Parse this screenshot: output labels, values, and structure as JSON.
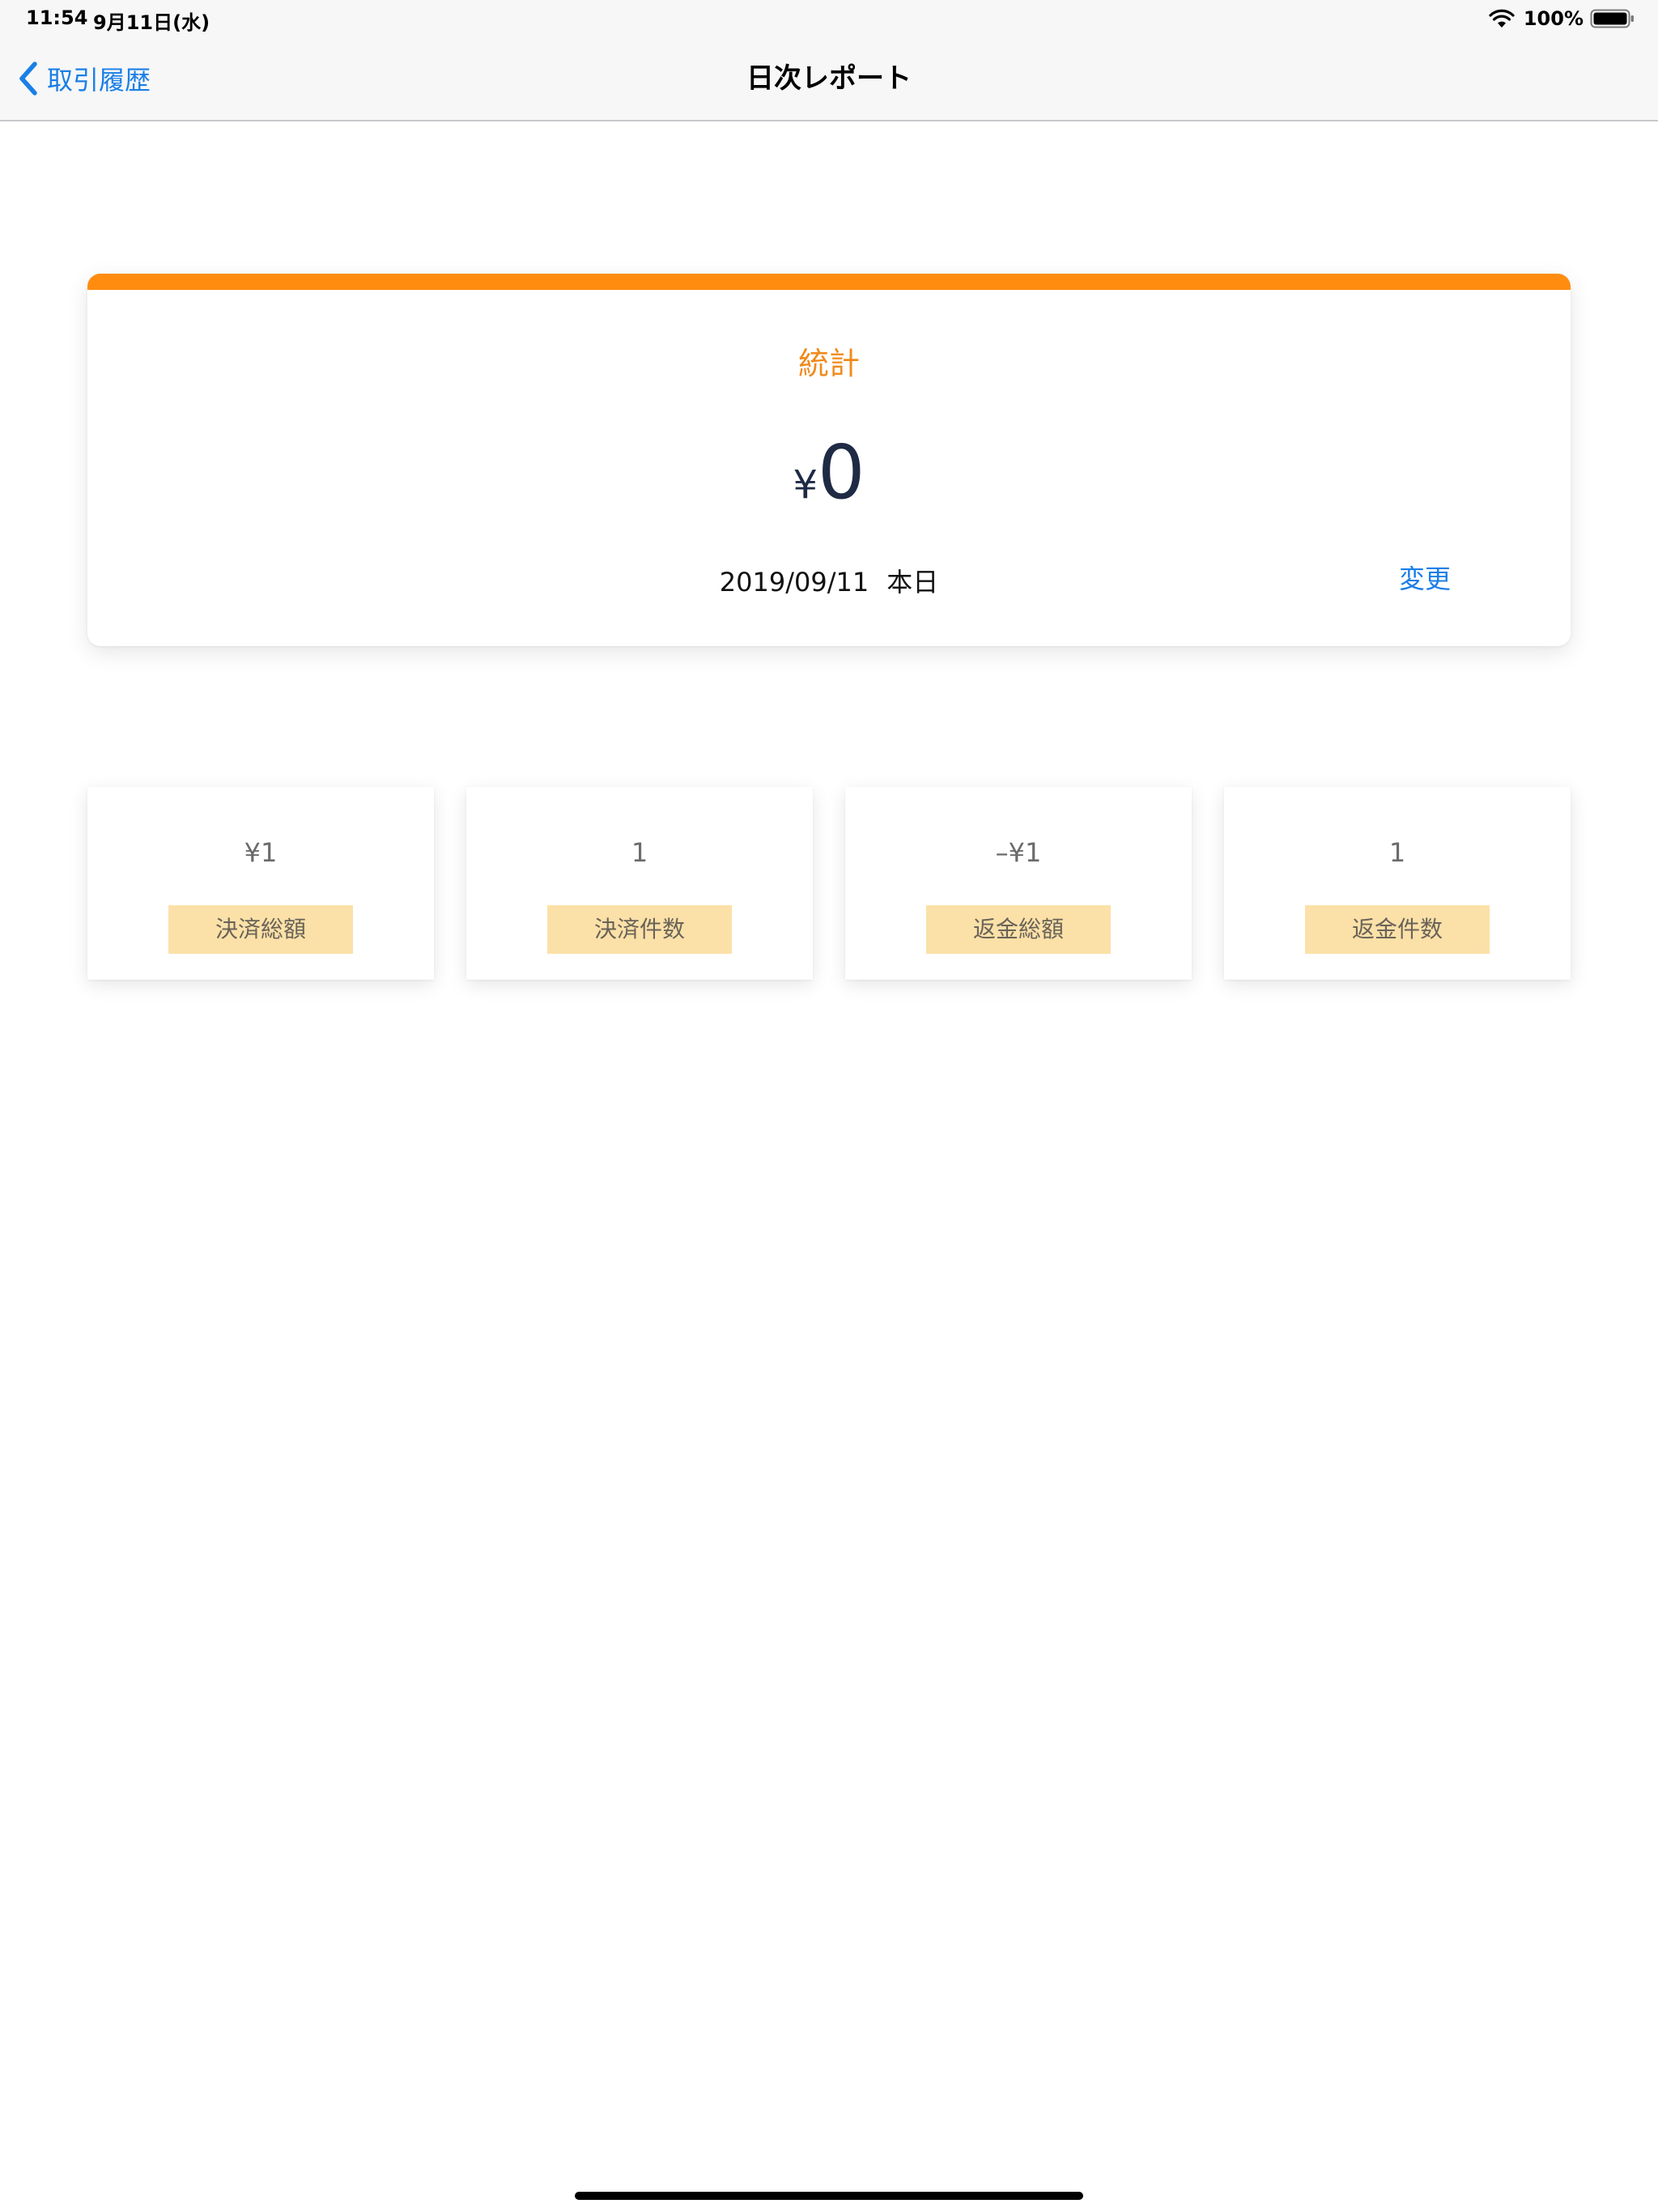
{
  "status_bar": {
    "time": "11:54",
    "date": "9月11日(水)",
    "battery": "100%",
    "wifi_icon": "wifi-icon",
    "battery_icon": "battery-icon"
  },
  "nav": {
    "back_label": "取引履歴",
    "back_icon": "chevron-left-icon",
    "title": "日次レポート"
  },
  "summary": {
    "title": "統計",
    "currency": "¥",
    "amount": "0",
    "date": "2019/09/11",
    "date_label": "本日",
    "change_label": "変更",
    "accent_color": "#ff8c0f"
  },
  "stats": [
    {
      "value": "¥1",
      "label": "決済総額"
    },
    {
      "value": "1",
      "label": "決済件数"
    },
    {
      "value": "–¥1",
      "label": "返金総額"
    },
    {
      "value": "1",
      "label": "返金件数"
    }
  ],
  "colors": {
    "link": "#1a7fe6",
    "label_bg": "#fbe1a8",
    "amount_text": "#1f2a44"
  }
}
